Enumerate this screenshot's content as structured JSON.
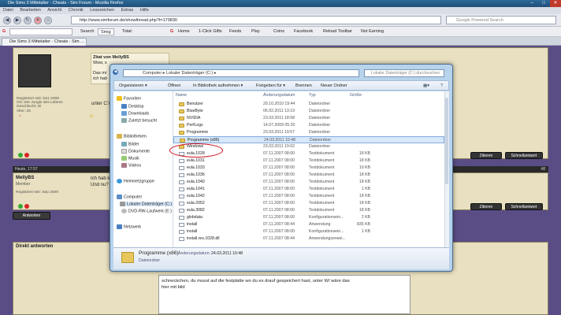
{
  "browser": {
    "title": "Die Sims 3 Mittelalter - Cheats - Sim Forum - Mozilla Firefox",
    "menu": [
      "Datei",
      "Bearbeiten",
      "Ansicht",
      "Chronik",
      "Lesezeichen",
      "Extras",
      "Hilfe"
    ],
    "url": "http://www.simforum.de/showthread.php?t=179830",
    "search_placeholder": "Google Powered Search",
    "toolbar": {
      "search_label": "Search",
      "smiley_label": "Smig",
      "total_label": "Total:",
      "home": "Home",
      "gifts": "1-Click Gifts",
      "feeds": "Feeds",
      "play": "Play",
      "coins": "Coins",
      "facebook": "Facebook",
      "reload": "Reload Toolbar",
      "earning": "Not Earning"
    },
    "tab_title": "Die Sims 3 Mittelalter - Cheats - Sim ..."
  },
  "forum": {
    "post1": {
      "quote_by": "Zitat von MellyBS",
      "quote_line1": "Wow, s",
      "quote_line2": "Das mi",
      "quote_line3": "Ich hab",
      "body_fragment": "unter C:\\Pro",
      "meta": [
        "Registriert seit: Dez 2009",
        "Ort: Der Jungle des Lebens",
        "Geschlecht: W",
        "Alter: 25"
      ]
    },
    "strip_time": "Heute, 17:57",
    "post_number": "#8",
    "post2": {
      "user": "MellyBS",
      "rank": "Member",
      "registered": "Registriert seit: Sep 2009",
      "body_line1": "Ich hab ke",
      "body_line2": "Und nu?"
    },
    "buttons": {
      "quote": "Zitieren",
      "quick": "Schnellantwort",
      "reply": "Antworten"
    },
    "direct_reply_label": "Direkt antworten",
    "reply_text_line1": "schneckchen, du musst auf die festplatte wo du es drauf gespeichert hast, unter W/ wäre das",
    "reply_text_line2": "hier mit bild"
  },
  "explorer": {
    "breadcrumb": "Computer ▸ Lokaler Datenträger (C:) ▸",
    "search_placeholder": "Lokaler Datenträger (C:) durchsuchen",
    "commands": [
      "Organisieren ▾",
      "Öffnen",
      "In Bibliothek aufnehmen ▾",
      "Freigeben für ▾",
      "Brennen",
      "Neuer Ordner"
    ],
    "nav": {
      "favorites": "Favoriten",
      "desktop": "Desktop",
      "downloads": "Downloads",
      "recent": "Zuletzt besucht",
      "libraries": "Bibliotheken",
      "pictures": "Bilder",
      "documents": "Dokumente",
      "music": "Musik",
      "videos": "Videos",
      "homegroup": "Heimnetzgruppe",
      "computer": "Computer",
      "local_disk": "Lokaler Datenträger (C:)",
      "dvd": "DVD-RW-Laufwerk (E:)",
      "network": "Netzwerk"
    },
    "columns": [
      "Name",
      "Änderungsdatum",
      "Typ",
      "Größe"
    ],
    "files": [
      {
        "name": "Benutzer",
        "date": "29.10.2010 19:44",
        "type": "Dateiordner",
        "size": "",
        "kind": "folder"
      },
      {
        "name": "BlueByte",
        "date": "06.02.2011 13:19",
        "type": "Dateiordner",
        "size": "",
        "kind": "folder"
      },
      {
        "name": "NVIDIA",
        "date": "23.03.2011 18:58",
        "type": "Dateiordner",
        "size": "",
        "kind": "folder"
      },
      {
        "name": "PerfLogs",
        "date": "14.07.2009 05:20",
        "type": "Dateiordner",
        "size": "",
        "kind": "folder"
      },
      {
        "name": "Programme",
        "date": "23.03.2011 19:57",
        "type": "Dateiordner",
        "size": "",
        "kind": "folder"
      },
      {
        "name": "Programme (x86)",
        "date": "24.03.2011 10:48",
        "type": "Dateiordner",
        "size": "",
        "kind": "folder",
        "selected": true
      },
      {
        "name": "Windows",
        "date": "23.03.2011 19:02",
        "type": "Dateiordner",
        "size": "",
        "kind": "folder"
      },
      {
        "name": "eula.1028",
        "date": "07.11.2007 08:00",
        "type": "Textdokument",
        "size": "18 KB",
        "kind": "doc"
      },
      {
        "name": "eula.1031",
        "date": "07.11.2007 08:00",
        "type": "Textdokument",
        "size": "18 KB",
        "kind": "doc"
      },
      {
        "name": "eula.1033",
        "date": "07.11.2007 08:00",
        "type": "Textdokument",
        "size": "10 KB",
        "kind": "doc"
      },
      {
        "name": "eula.1036",
        "date": "07.11.2007 08:00",
        "type": "Textdokument",
        "size": "18 KB",
        "kind": "doc"
      },
      {
        "name": "eula.1040",
        "date": "07.11.2007 08:00",
        "type": "Textdokument",
        "size": "18 KB",
        "kind": "doc"
      },
      {
        "name": "eula.1041",
        "date": "07.11.2007 08:00",
        "type": "Textdokument",
        "size": "1 KB",
        "kind": "doc"
      },
      {
        "name": "eula.1042",
        "date": "07.11.2007 08:00",
        "type": "Textdokument",
        "size": "18 KB",
        "kind": "doc"
      },
      {
        "name": "eula.2052",
        "date": "07.11.2007 08:00",
        "type": "Textdokument",
        "size": "18 KB",
        "kind": "doc"
      },
      {
        "name": "eula.3082",
        "date": "07.11.2007 08:00",
        "type": "Textdokument",
        "size": "18 KB",
        "kind": "doc"
      },
      {
        "name": "globdata",
        "date": "07.11.2007 08:00",
        "type": "Konfigurationsein...",
        "size": "2 KB",
        "kind": "doc"
      },
      {
        "name": "install",
        "date": "07.11.2007 08:44",
        "type": "Anwendung",
        "size": "835 KB",
        "kind": "doc"
      },
      {
        "name": "install",
        "date": "07.11.2007 08:00",
        "type": "Konfigurationsein...",
        "size": "1 KB",
        "kind": "doc"
      },
      {
        "name": "install.res.1028.dll",
        "date": "07.11.2007 08:44",
        "type": "Anwendungserwei...",
        "size": "",
        "kind": "doc"
      }
    ],
    "details": {
      "name": "Programme (x86)",
      "date_label": "Änderungsdatum:",
      "date": "24.03.2011 10:48",
      "type": "Dateiordner"
    }
  },
  "colors": {
    "forum_bg": "#5a4d86",
    "post_bg": "#e8e0c0",
    "highlight_circle": "#d0101e"
  }
}
